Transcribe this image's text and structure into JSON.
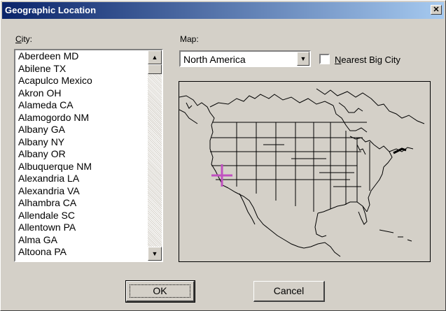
{
  "window": {
    "title": "Geographic Location",
    "close_symbol": "✕"
  },
  "city": {
    "label_accel": "C",
    "label_rest": "ity:",
    "items": [
      "Aberdeen MD",
      "Abilene TX",
      "Acapulco Mexico",
      "Akron OH",
      "Alameda CA",
      "Alamogordo NM",
      "Albany GA",
      "Albany NY",
      "Albany OR",
      "Albuquerque NM",
      "Alexandria LA",
      "Alexandria VA",
      "Alhambra CA",
      "Allendale SC",
      "Allentown PA",
      "Alma  GA",
      "Altoona PA"
    ]
  },
  "map": {
    "label": "Map:",
    "selected": "North America",
    "marker_icon": "crosshair-marker-icon",
    "marker_color": "#c050c0"
  },
  "nearest": {
    "accel": "N",
    "rest": "earest Big City",
    "checked": false
  },
  "buttons": {
    "ok": "OK",
    "cancel": "Cancel"
  }
}
